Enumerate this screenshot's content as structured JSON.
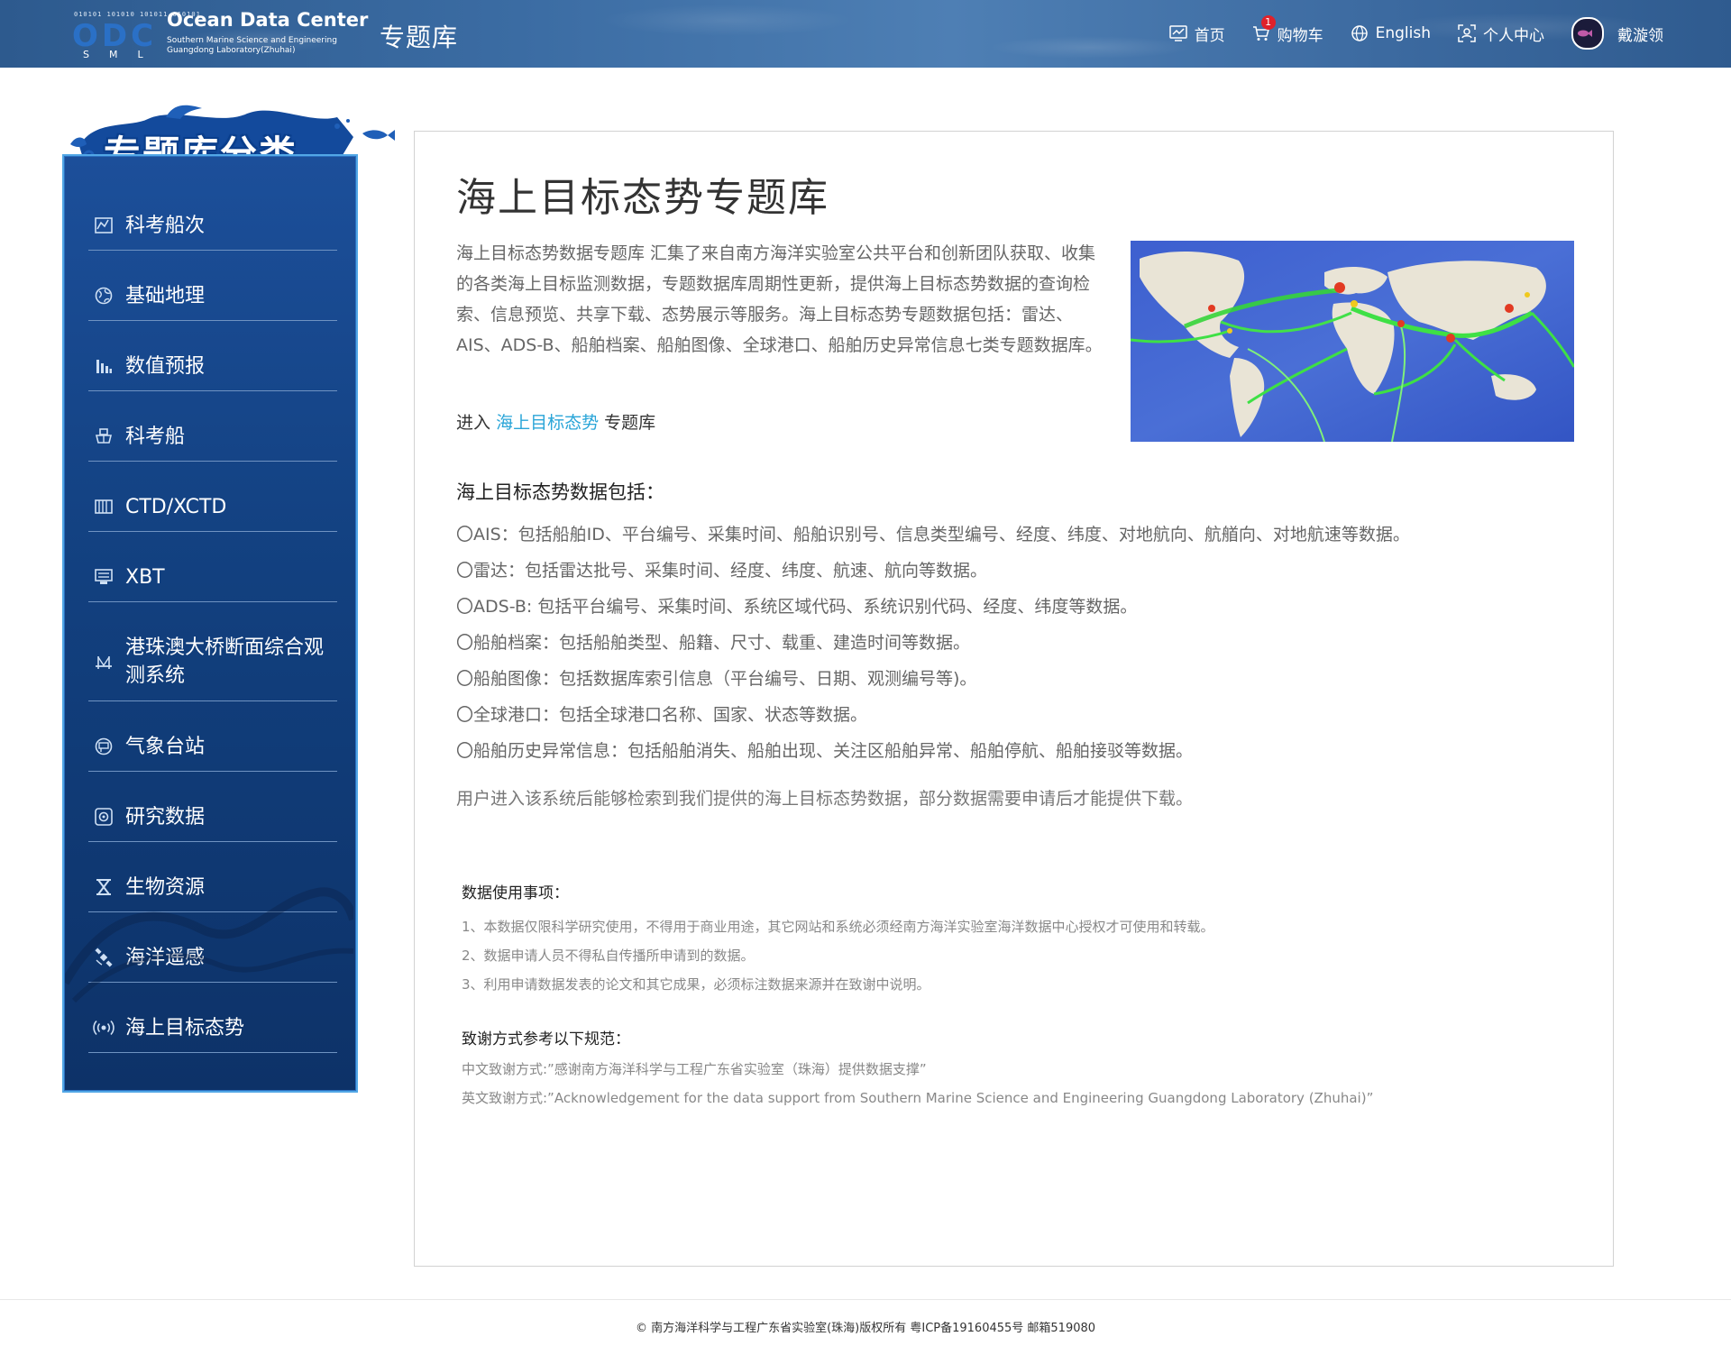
{
  "header": {
    "logo_bits": "010101 101010 101011 010101",
    "logo_mark": "ODC",
    "logo_letters": "SML",
    "logo_title": "Ocean Data Center",
    "logo_sub_line1": "Southern Marine Science and Engineering",
    "logo_sub_line2": "Guangdong Laboratory(Zhuhai)",
    "page_label": "专题库",
    "nav": {
      "home": "首页",
      "cart": "购物车",
      "cart_count": "1",
      "language": "English",
      "profile": "个人中心",
      "user_name": "戴漩领"
    }
  },
  "sidebar": {
    "title": "专题库分类",
    "items": [
      {
        "label": "科考船次",
        "icon": "voyage-chart-icon"
      },
      {
        "label": "基础地理",
        "icon": "globe-icon"
      },
      {
        "label": "数值预报",
        "icon": "bar-chart-icon"
      },
      {
        "label": "科考船",
        "icon": "ship-icon"
      },
      {
        "label": "CTD/XCTD",
        "icon": "ctd-device-icon"
      },
      {
        "label": "XBT",
        "icon": "xbt-device-icon"
      },
      {
        "label": "港珠澳大桥断面综合观测系统",
        "icon": "bridge-icon"
      },
      {
        "label": "气象台站",
        "icon": "weather-station-icon"
      },
      {
        "label": "研究数据",
        "icon": "research-icon"
      },
      {
        "label": "生物资源",
        "icon": "hourglass-icon"
      },
      {
        "label": "海洋遥感",
        "icon": "satellite-icon"
      },
      {
        "label": "海上目标态势",
        "icon": "signal-icon"
      }
    ]
  },
  "main": {
    "title": "海上目标态势专题库",
    "intro": "海上目标态势数据专题库 汇集了来自南方海洋实验室公共平台和创新团队获取、收集的各类海上目标监测数据，专题数据库周期性更新，提供海上目标态势数据的查询检索、信息预览、共享下载、态势展示等服务。海上目标态势专题数据包括：雷达、AIS、ADS-B、船舶档案、船舶图像、全球港口、船舶历史异常信息七类专题数据库。",
    "enter_prefix": "进入",
    "enter_link": "海上目标态势",
    "enter_suffix": "专题库",
    "includes_title": "海上目标态势数据包括：",
    "includes": [
      "〇AIS：包括船舶ID、平台编号、采集时间、船舶识别号、信息类型编号、经度、纬度、对地航向、航艏向、对地航速等数据。",
      "〇雷达：包括雷达批号、采集时间、经度、纬度、航速、航向等数据。",
      "〇ADS-B: 包括平台编号、采集时间、系统区域代码、系统识别代码、经度、纬度等数据。",
      "〇船舶档案：包括船舶类型、船籍、尺寸、载重、建造时间等数据。",
      "〇船舶图像：包括数据库索引信息（平台编号、日期、观测编号等)。",
      "〇全球港口：包括全球港口名称、国家、状态等数据。",
      "〇船舶历史异常信息：包括船舶消失、船舶出现、关注区船舶异常、船舶停航、船舶接驳等数据。"
    ],
    "user_note": "用户进入该系统后能够检索到我们提供的海上目标态势数据，部分数据需要申请后才能提供下载。",
    "usage_title": "数据使用事项：",
    "usage": [
      "1、本数据仅限科学研究使用，不得用于商业用途，其它网站和系统必须经南方海洋实验室海洋数据中心授权才可使用和转载。",
      "2、数据申请人员不得私自传播所申请到的数据。",
      "3、利用申请数据发表的论文和其它成果，必须标注数据来源并在致谢中说明。"
    ],
    "ack_title": "致谢方式参考以下规范：",
    "ack": [
      "中文致谢方式:”感谢南方海洋科学与工程广东省实验室（珠海）提供数据支撑”",
      "英文致谢方式:”Acknowledgement for the data support from Southern Marine Science and Engineering Guangdong Laboratory (Zhuhai)”"
    ]
  },
  "footer": {
    "text": "© 南方海洋科学与工程广东省实验室(珠海)版权所有   粤ICP备19160455号   邮箱519080"
  },
  "colors": {
    "header_bg": "#3b6ca3",
    "sidebar_bg": "#12407f",
    "sidebar_border": "#52a7e6",
    "link": "#2aa5d8",
    "badge": "#e0212a"
  }
}
